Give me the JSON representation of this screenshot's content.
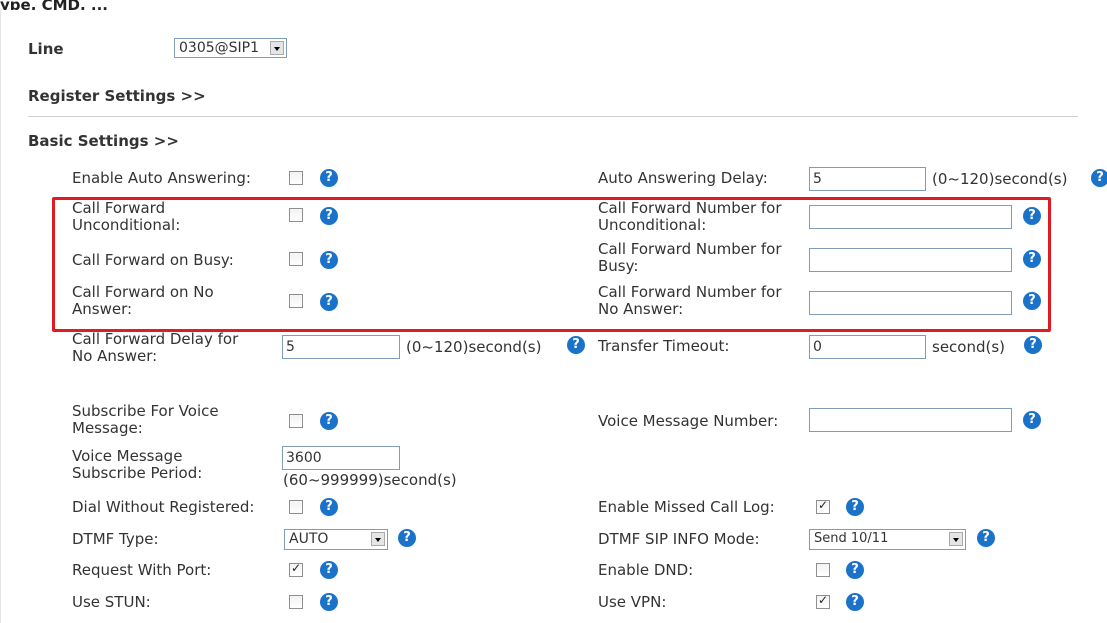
{
  "top_cut_text": "ype, CMD, ...",
  "line": {
    "label": "Line",
    "value": "0305@SIP1"
  },
  "register_settings": "Register Settings >>",
  "basic_settings": "Basic Settings >>",
  "auto_answer": {
    "label": "Enable Auto Answering:",
    "checked": false
  },
  "auto_answer_delay": {
    "label": "Auto Answering Delay:",
    "value": "5",
    "unit": "(0~120)second(s)"
  },
  "cf_unconditional": {
    "label_1": "Call Forward",
    "label_2": "Unconditional:",
    "checked": false
  },
  "cf_num_unconditional": {
    "label_1": "Call Forward Number for",
    "label_2": "Unconditional:",
    "value": ""
  },
  "cf_busy": {
    "label": "Call Forward on Busy:",
    "checked": false
  },
  "cf_num_busy": {
    "label_1": "Call Forward Number for",
    "label_2": "Busy:",
    "value": ""
  },
  "cf_noanswer": {
    "label_1": "Call Forward on No",
    "label_2": "Answer:",
    "checked": false
  },
  "cf_num_noanswer": {
    "label_1": "Call Forward Number for",
    "label_2": "No Answer:",
    "value": ""
  },
  "cf_delay": {
    "label_1": "Call Forward Delay for",
    "label_2": "No Answer:",
    "value": "5",
    "unit": "(0~120)second(s)"
  },
  "transfer_timeout": {
    "label": "Transfer Timeout:",
    "value": "0",
    "unit": "second(s)"
  },
  "sub_voice": {
    "label_1": "Subscribe For Voice",
    "label_2": "Message:",
    "checked": false
  },
  "voice_msg_number": {
    "label": "Voice Message Number:",
    "value": ""
  },
  "vm_sub_period": {
    "label_1": "Voice Message",
    "label_2": "Subscribe Period:",
    "value": "3600",
    "unit": "(60~999999)second(s)"
  },
  "dial_without_reg": {
    "label": "Dial Without Registered:",
    "checked": false
  },
  "missed_call_log": {
    "label": "Enable Missed Call Log:",
    "checked": true
  },
  "dtmf_type": {
    "label": "DTMF Type:",
    "value": "AUTO"
  },
  "dtmf_sip_info": {
    "label": "DTMF SIP INFO Mode:",
    "value": "Send 10/11"
  },
  "request_with_port": {
    "label": "Request With Port:",
    "checked": true
  },
  "enable_dnd": {
    "label": "Enable DND:",
    "checked": false
  },
  "use_stun": {
    "label": "Use STUN:",
    "checked": false
  },
  "use_vpn": {
    "label": "Use VPN:",
    "checked": true
  },
  "help_glyph": "?",
  "colors": {
    "highlight": "#e11b22",
    "help": "#1a73c9"
  }
}
